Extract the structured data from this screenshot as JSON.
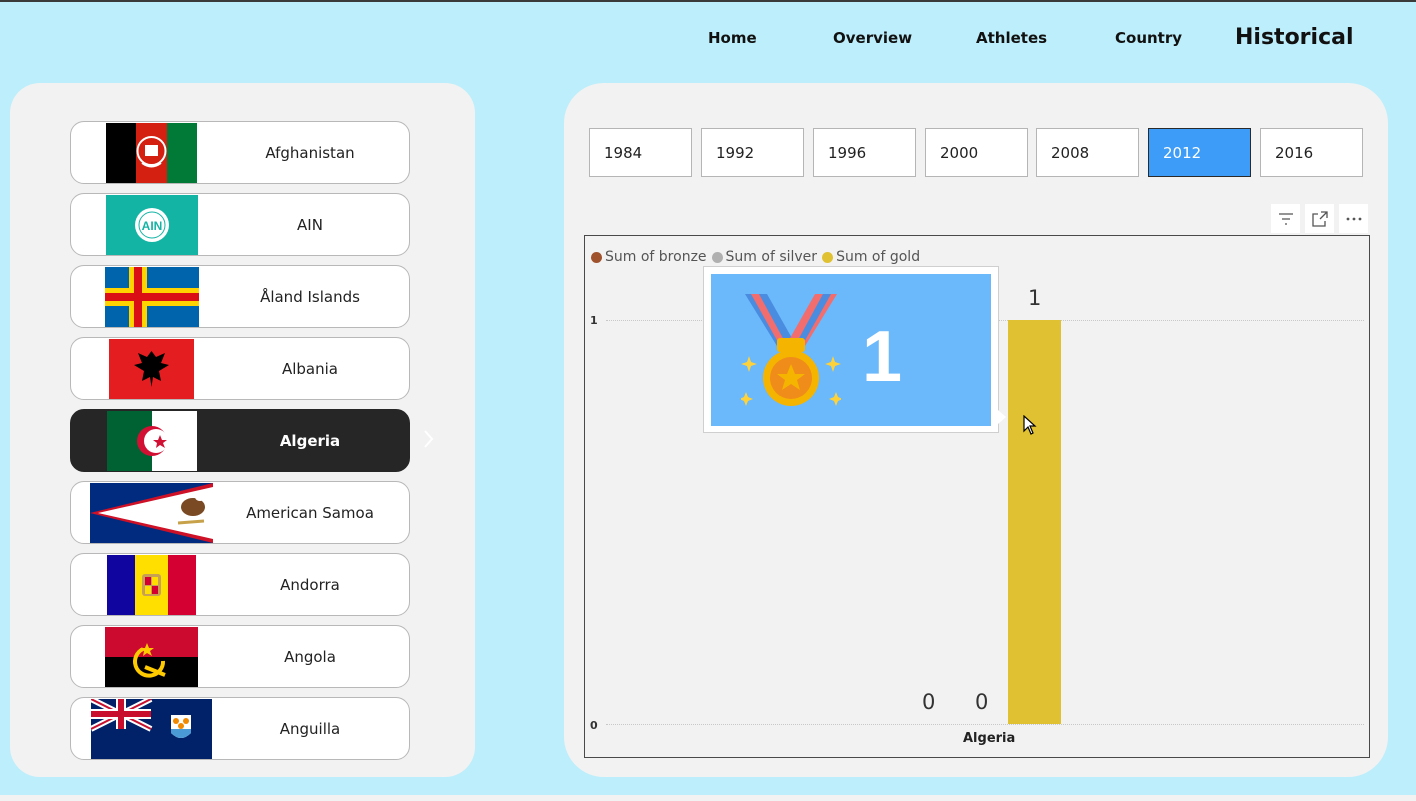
{
  "nav": {
    "home": "Home",
    "overview": "Overview",
    "athletes": "Athletes",
    "country": "Country",
    "historical": "Historical"
  },
  "countries": [
    {
      "name": "Afghanistan",
      "selected": false
    },
    {
      "name": "AIN",
      "selected": false,
      "flag_text": "AIN"
    },
    {
      "name": "Åland Islands",
      "selected": false
    },
    {
      "name": "Albania",
      "selected": false
    },
    {
      "name": "Algeria",
      "selected": true
    },
    {
      "name": "American Samoa",
      "selected": false
    },
    {
      "name": "Andorra",
      "selected": false
    },
    {
      "name": "Angola",
      "selected": false
    },
    {
      "name": "Anguilla",
      "selected": false
    }
  ],
  "years": [
    {
      "label": "1984",
      "selected": false
    },
    {
      "label": "1992",
      "selected": false
    },
    {
      "label": "1996",
      "selected": false
    },
    {
      "label": "2000",
      "selected": false
    },
    {
      "label": "2008",
      "selected": false
    },
    {
      "label": "2012",
      "selected": true
    },
    {
      "label": "2016",
      "selected": false
    }
  ],
  "visual_header": {
    "icons": [
      "filter-icon",
      "focus-mode-icon",
      "more-options-icon"
    ]
  },
  "tooltip": {
    "value": "1",
    "icon": "medal-icon"
  },
  "colors": {
    "background": "#bdeefb",
    "accent": "#3d9cf7",
    "bronze": "#a0522d",
    "silver": "#b0b0b0",
    "gold": "#e0c132"
  },
  "chart_data": {
    "type": "bar",
    "categories": [
      "Algeria"
    ],
    "series": [
      {
        "name": "Sum of bronze",
        "values": [
          0
        ]
      },
      {
        "name": "Sum of silver",
        "values": [
          0
        ]
      },
      {
        "name": "Sum of gold",
        "values": [
          1
        ]
      }
    ],
    "data_labels": [
      "0",
      "0",
      "1"
    ],
    "yticks": [
      "1",
      "0"
    ],
    "ylim": [
      0,
      1
    ],
    "grid": true,
    "legend": "top-left"
  }
}
